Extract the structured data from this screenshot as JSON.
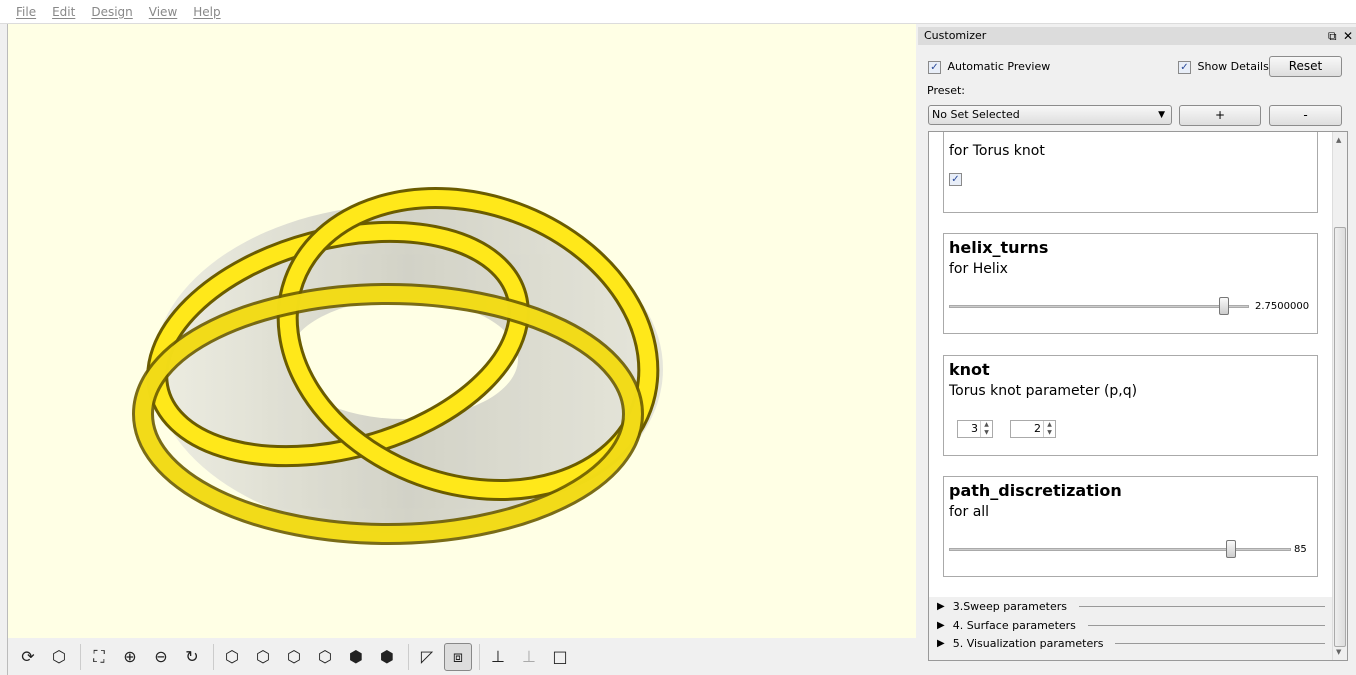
{
  "menu": [
    "File",
    "Edit",
    "Design",
    "View",
    "Help"
  ],
  "toolbar": {
    "icons": [
      "preview-render-icon",
      "render-icon",
      "view-all-icon",
      "zoom-in-icon",
      "zoom-out-icon",
      "reset-view-icon",
      "view-right-icon",
      "view-top-icon",
      "view-bottom-icon",
      "view-left-icon",
      "view-front-icon",
      "view-back-icon",
      "perspective-icon",
      "orthogonal-icon",
      "show-axes-icon",
      "show-scale-icon",
      "show-edges-icon"
    ],
    "active": "orthogonal-icon"
  },
  "customizer": {
    "title": "Customizer",
    "automatic_preview": {
      "label": "Automatic Preview",
      "checked": true
    },
    "show_details": {
      "label": "Show Details",
      "checked": true
    },
    "reset": "Reset",
    "preset_label": "Preset:",
    "preset_value": "No Set Selected",
    "add": "+",
    "remove": "-",
    "params": [
      {
        "description": "for Torus knot",
        "checked": true
      },
      {
        "name": "helix_turns",
        "description": "for Helix",
        "value": "2.7500000",
        "fraction": 0.95
      },
      {
        "name": "knot",
        "description": "Torus knot parameter (p,q)",
        "p": "3",
        "q": "2"
      },
      {
        "name": "path_discretization",
        "description": "for all",
        "value": "85",
        "fraction": 0.82
      }
    ],
    "groups": [
      "3.Sweep parameters",
      "4. Surface parameters",
      "5. Visualization parameters"
    ]
  },
  "colors": {
    "viewport_bg": "#ffffe5",
    "knot": "#ffe81a",
    "torus": "#d8d8d0"
  }
}
